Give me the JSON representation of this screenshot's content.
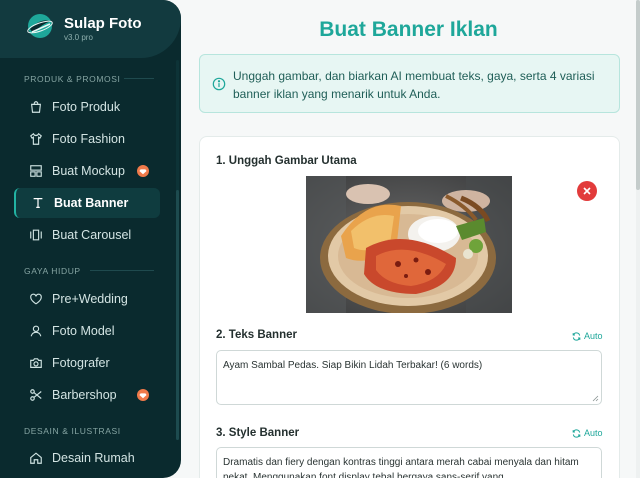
{
  "app": {
    "name": "Sulap Foto",
    "version": "v3.0 pro"
  },
  "sidebar": {
    "sections": [
      {
        "title": "PRODUK & PROMOSI"
      },
      {
        "title": "GAYA HIDUP"
      },
      {
        "title": "DESAIN & ILUSTRASI"
      }
    ],
    "items": [
      {
        "label": "Foto Produk",
        "icon": "shopping-bag-icon"
      },
      {
        "label": "Foto Fashion",
        "icon": "shirt-icon"
      },
      {
        "label": "Buat Mockup",
        "icon": "layout-icon",
        "badge": "gem-icon"
      },
      {
        "label": "Buat Banner",
        "icon": "text-icon",
        "active": true
      },
      {
        "label": "Buat Carousel",
        "icon": "carousel-icon"
      },
      {
        "label": "Pre+Wedding",
        "icon": "heart-icon"
      },
      {
        "label": "Foto Model",
        "icon": "user-icon"
      },
      {
        "label": "Fotografer",
        "icon": "camera-icon"
      },
      {
        "label": "Barbershop",
        "icon": "scissors-icon",
        "badge": "gem-icon"
      },
      {
        "label": "Desain Rumah",
        "icon": "home-icon"
      }
    ]
  },
  "main": {
    "title": "Buat Banner Iklan",
    "info": "Unggah gambar, dan biarkan AI membuat teks, gaya, serta 4 variasi banner iklan yang menarik untuk Anda.",
    "upload": {
      "label": "1. Unggah Gambar Utama"
    },
    "banner_text": {
      "label": "2. Teks Banner",
      "auto_label": "Auto",
      "value": "Ayam Sambal Pedas. Siap Bikin Lidah Terbakar! (6 words)"
    },
    "banner_style": {
      "label": "3. Style Banner",
      "auto_label": "Auto",
      "value": "Dramatis dan fiery dengan kontras tinggi antara merah cabai menyala dan hitam pekat. Menggunakan font display tebal bergaya sans-serif yang"
    }
  },
  "colors": {
    "accent": "#1ea79a",
    "sidebar_bg": "#0a2a2e",
    "danger": "#e23b3b",
    "badge": "#f07a4a"
  }
}
